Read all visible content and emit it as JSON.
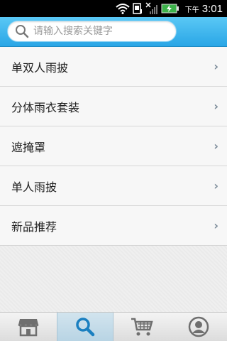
{
  "status_bar": {
    "time_suffix": "下午",
    "time": "3:01",
    "icons": [
      "wifi-icon",
      "sim-icon",
      "no-signal-icon",
      "battery-charging-icon"
    ]
  },
  "search": {
    "placeholder": "请输入搜索关键字",
    "value": ""
  },
  "categories": [
    {
      "label": "单双人雨披"
    },
    {
      "label": "分体雨衣套装"
    },
    {
      "label": "遮掩罩"
    },
    {
      "label": "单人雨披"
    },
    {
      "label": "新品推荐"
    }
  ],
  "chevron_glyph": "›",
  "tabs": [
    {
      "icon": "store-icon",
      "active": false
    },
    {
      "icon": "search-icon",
      "active": true
    },
    {
      "icon": "cart-icon",
      "active": false
    },
    {
      "icon": "user-icon",
      "active": false
    }
  ],
  "colors": {
    "header_blue": "#2aa6e6",
    "active_tab": "#c4dcea",
    "icon_gray": "#6f6f6f",
    "search_icon_blue": "#1a7fc0"
  }
}
